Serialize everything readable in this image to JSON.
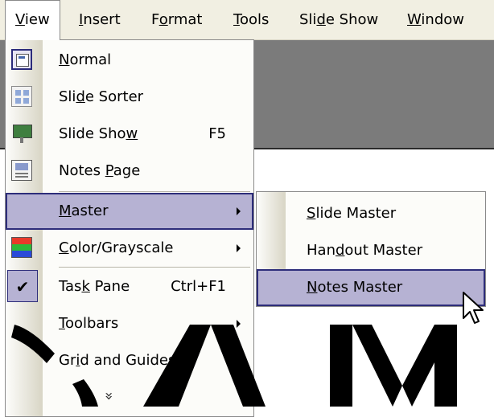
{
  "menubar": {
    "items": [
      "View",
      "Insert",
      "Format",
      "Tools",
      "Slide Show",
      "Window"
    ],
    "items_parts": [
      [
        "",
        "V",
        "iew"
      ],
      [
        "",
        "I",
        "nsert"
      ],
      [
        "F",
        "o",
        "rmat"
      ],
      [
        "",
        "T",
        "ools"
      ],
      [
        "Sli",
        "d",
        "e Show"
      ],
      [
        "",
        "W",
        "indow"
      ]
    ]
  },
  "view_menu": {
    "items": [
      {
        "label": "Normal",
        "parts": [
          "",
          "N",
          "ormal"
        ],
        "icon": "normal-view-icon"
      },
      {
        "label": "Slide Sorter",
        "parts": [
          "Sli",
          "d",
          "e Sorter"
        ],
        "icon": "slide-sorter-icon"
      },
      {
        "label": "Slide Show",
        "parts": [
          "Slide Sho",
          "w",
          ""
        ],
        "shortcut": "F5",
        "icon": "slide-show-icon"
      },
      {
        "label": "Notes Page",
        "parts": [
          "Notes ",
          "P",
          "age"
        ],
        "icon": "notes-page-icon"
      },
      {
        "label": "Master",
        "parts": [
          "",
          "M",
          "aster"
        ],
        "submenu": true,
        "highlighted": true
      },
      {
        "label": "Color/Grayscale",
        "parts": [
          "",
          "C",
          "olor/Grayscale"
        ],
        "submenu": true,
        "icon": "color-grayscale-icon"
      },
      {
        "label": "Task Pane",
        "parts": [
          "Tas",
          "k",
          " Pane"
        ],
        "shortcut": "Ctrl+F1",
        "checked": true
      },
      {
        "label": "Toolbars",
        "parts": [
          "",
          "T",
          "oolbars"
        ],
        "submenu": true
      },
      {
        "label": "Grid and Guides...",
        "parts": [
          "Gr",
          "i",
          "d and Guides..."
        ]
      }
    ],
    "expand_glyph": "»"
  },
  "master_submenu": {
    "items": [
      {
        "label": "Slide Master",
        "parts": [
          "",
          "S",
          "lide Master"
        ]
      },
      {
        "label": "Handout Master",
        "parts": [
          "Han",
          "d",
          "out Master"
        ]
      },
      {
        "label": "Notes Master",
        "parts": [
          "",
          "N",
          "otes Master"
        ],
        "highlighted": true
      }
    ]
  },
  "colors": {
    "highlight_fill": "#b6b2d3",
    "highlight_border": "#2d2d7a",
    "menu_bg": "#fcfcf9",
    "app_dark": "#7b7b7b"
  }
}
